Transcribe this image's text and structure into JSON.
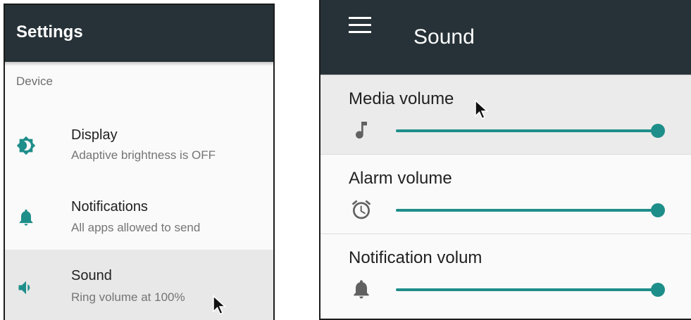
{
  "left_panel": {
    "title": "Settings",
    "category": "Device",
    "items": [
      {
        "title": "Display",
        "subtitle": "Adaptive brightness is OFF",
        "icon": "brightness-icon"
      },
      {
        "title": "Notifications",
        "subtitle": "All apps allowed to send",
        "icon": "bell-icon"
      },
      {
        "title": "Sound",
        "subtitle": "Ring volume at 100%",
        "icon": "speaker-icon"
      }
    ]
  },
  "right_panel": {
    "title": "Sound",
    "menu_icon": "hamburger-menu-icon",
    "volumes": [
      {
        "label": "Media volume",
        "icon": "music-note-icon",
        "level": 1.0
      },
      {
        "label": "Alarm volume",
        "icon": "alarm-clock-icon",
        "level": 1.0
      },
      {
        "label": "Notification volum",
        "icon": "bell-icon",
        "level": 1.0
      }
    ]
  },
  "colors": {
    "toolbar": "#263238",
    "accent": "#1e8e8a",
    "selected_row": "#e8e8e8"
  }
}
